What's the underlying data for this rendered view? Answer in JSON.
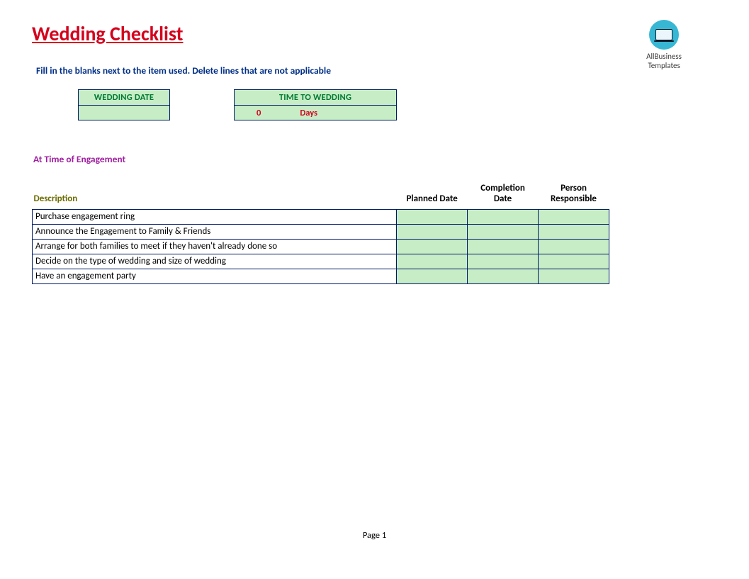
{
  "title": "Wedding Checklist",
  "logo": {
    "line1": "AllBusiness",
    "line2": "Templates"
  },
  "instructions": "Fill in the blanks next to the item used.  Delete lines that are not applicable",
  "boxes": {
    "wedding_date": {
      "label": "WEDDING DATE",
      "value": ""
    },
    "time_to_wedding": {
      "label": "TIME TO WEDDING",
      "value_num": "0",
      "value_unit": "Days"
    }
  },
  "section": {
    "title": "At Time of Engagement",
    "headers": {
      "description": "Description",
      "planned": "Planned Date",
      "completion": "Completion Date",
      "responsible": "Person Responsible"
    },
    "rows": [
      {
        "desc": "Purchase engagement ring",
        "planned": "",
        "completion": "",
        "responsible": ""
      },
      {
        "desc": "Announce the Engagement to Family & Friends",
        "planned": "",
        "completion": "",
        "responsible": ""
      },
      {
        "desc": "Arrange for both families to meet if they haven't already done so",
        "planned": "",
        "completion": "",
        "responsible": ""
      },
      {
        "desc": "Decide on the type of wedding and size of wedding",
        "planned": "",
        "completion": "",
        "responsible": ""
      },
      {
        "desc": "Have an engagement party",
        "planned": "",
        "completion": "",
        "responsible": ""
      }
    ]
  },
  "footer": "Page 1"
}
